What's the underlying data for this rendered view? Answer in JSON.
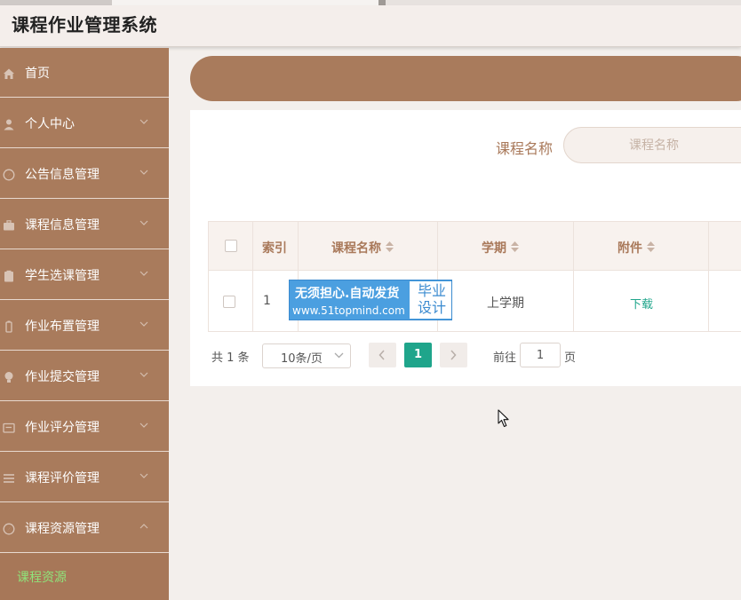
{
  "app": {
    "title": "课程作业管理系统"
  },
  "colors": {
    "accent": "#a97b5c",
    "active_sub": "#8fe47a",
    "primary": "#1fa58b"
  },
  "sidebar": {
    "items": [
      {
        "label": "首页",
        "icon": "home-icon",
        "arrow": ""
      },
      {
        "label": "个人中心",
        "icon": "user-icon",
        "arrow": "chevron-down-icon"
      },
      {
        "label": "公告信息管理",
        "icon": "compass-icon",
        "arrow": "chevron-down-icon"
      },
      {
        "label": "课程信息管理",
        "icon": "briefcase-icon",
        "arrow": "chevron-down-icon"
      },
      {
        "label": "学生选课管理",
        "icon": "clipboard-icon",
        "arrow": "chevron-down-icon"
      },
      {
        "label": "作业布置管理",
        "icon": "battery-icon",
        "arrow": "chevron-down-icon"
      },
      {
        "label": "作业提交管理",
        "icon": "bulb-icon",
        "arrow": "chevron-down-icon"
      },
      {
        "label": "作业评分管理",
        "icon": "card-icon",
        "arrow": "chevron-down-icon"
      },
      {
        "label": "课程评价管理",
        "icon": "list-icon",
        "arrow": "chevron-down-icon"
      },
      {
        "label": "课程资源管理",
        "icon": "compass-icon",
        "arrow": "chevron-up-icon"
      }
    ],
    "sub_item": "课程资源"
  },
  "search": {
    "label": "课程名称",
    "placeholder": "课程名称"
  },
  "table": {
    "columns": [
      "索引",
      "课程名称",
      "学期",
      "附件"
    ],
    "rows": [
      {
        "index": "1",
        "course": "",
        "term": "上学期",
        "attachment": "下载"
      }
    ]
  },
  "watermark": {
    "line1": "无须担心.自动发货",
    "line2": "www.51topmind.com",
    "badge": "毕业设计"
  },
  "pagination": {
    "total": "共 1 条",
    "page_size": "10条/页",
    "current_page": "1",
    "goto_label": "前往",
    "goto_value": "1",
    "page_suffix": "页"
  }
}
